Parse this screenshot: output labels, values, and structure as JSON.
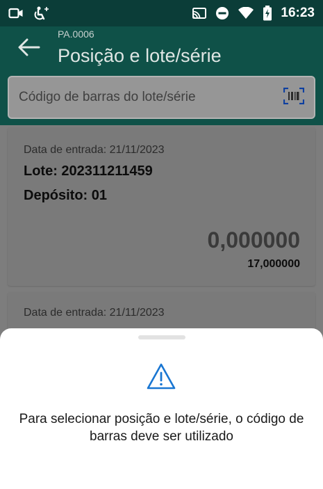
{
  "status_bar": {
    "time": "16:23",
    "icons": [
      "video-camera-icon",
      "accessibility-icon",
      "cast-icon",
      "do-not-disturb-icon",
      "wifi-icon",
      "battery-charging-icon"
    ]
  },
  "header": {
    "subtitle": "PA.0006",
    "title": "Posição e lote/série",
    "back_icon": "arrow-left-icon"
  },
  "search": {
    "placeholder": "Código de barras do lote/série",
    "icon": "barcode-scanner-icon"
  },
  "cards": [
    {
      "entry_date": "Data de entrada: 21/11/2023",
      "lot": "Lote: 202311211459",
      "deposit": "Depósito: 01",
      "quantity": "0,000000",
      "quantity_total": "17,000000"
    },
    {
      "entry_date": "Data de entrada: 21/11/2023"
    }
  ],
  "bottom_sheet": {
    "icon": "warning-icon",
    "message": "Para selecionar posição e lote/série, o código de barras deve ser utilizado"
  },
  "colors": {
    "status_bar": "#0b3d38",
    "app_bar": "#0f5148",
    "accent": "#1976d2"
  }
}
